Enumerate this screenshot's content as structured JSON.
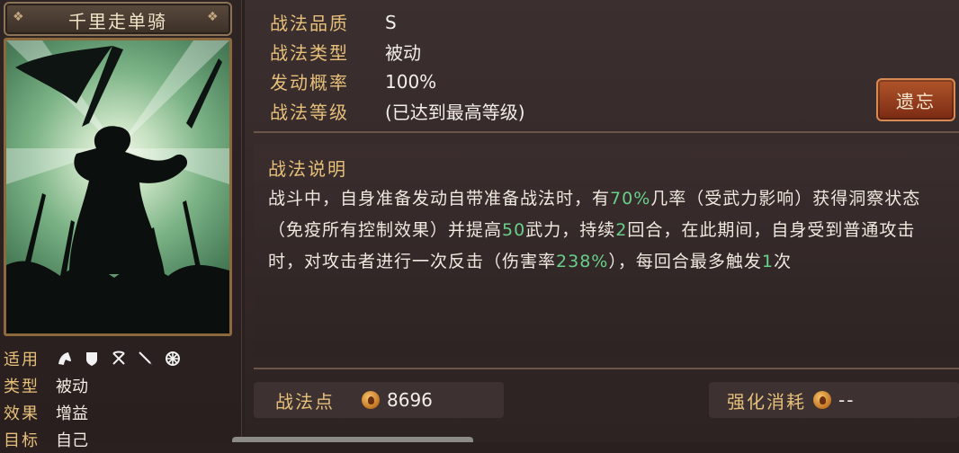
{
  "skill": {
    "name": "千里走单骑"
  },
  "meta": {
    "applicable_label": "适用",
    "type_label": "类型",
    "type_value": "被动",
    "effect_label": "效果",
    "effect_value": "增益",
    "target_label": "目标",
    "target_value": "自己",
    "unit_icons": [
      "cavalry-icon",
      "shield-icon",
      "archer-icon",
      "spear-icon",
      "siege-icon"
    ]
  },
  "attrs": [
    {
      "label": "战法品质",
      "value": "S"
    },
    {
      "label": "战法类型",
      "value": "被动"
    },
    {
      "label": "发动概率",
      "value": "100%"
    },
    {
      "label": "战法等级",
      "value": "(已达到最高等级)"
    }
  ],
  "buttons": {
    "forget": "遗忘"
  },
  "description": {
    "title": "战法说明",
    "segments": [
      {
        "text": "战斗中，自身准备发动自带准备战法时，有",
        "hl": false
      },
      {
        "text": "70%",
        "hl": true
      },
      {
        "text": "几率（受武力影响）获得洞察状态（免疫所有控制效果）并提高",
        "hl": false
      },
      {
        "text": "50",
        "hl": true
      },
      {
        "text": "武力，持续",
        "hl": false
      },
      {
        "text": "2",
        "hl": true
      },
      {
        "text": "回合，在此期间，自身受到普通攻击时，对攻击者进行一次反击（伤害率",
        "hl": false
      },
      {
        "text": "238%",
        "hl": true
      },
      {
        "text": "），每回合最多触发",
        "hl": false
      },
      {
        "text": "1",
        "hl": true
      },
      {
        "text": "次",
        "hl": false
      }
    ]
  },
  "footer": {
    "points_label": "战法点",
    "points_value": "8696",
    "cost_label": "强化消耗",
    "cost_value": "--"
  },
  "colors": {
    "accent_gold": "#e6c07a",
    "highlight_green": "#68d08a",
    "button_red": "#9b3f1c"
  }
}
